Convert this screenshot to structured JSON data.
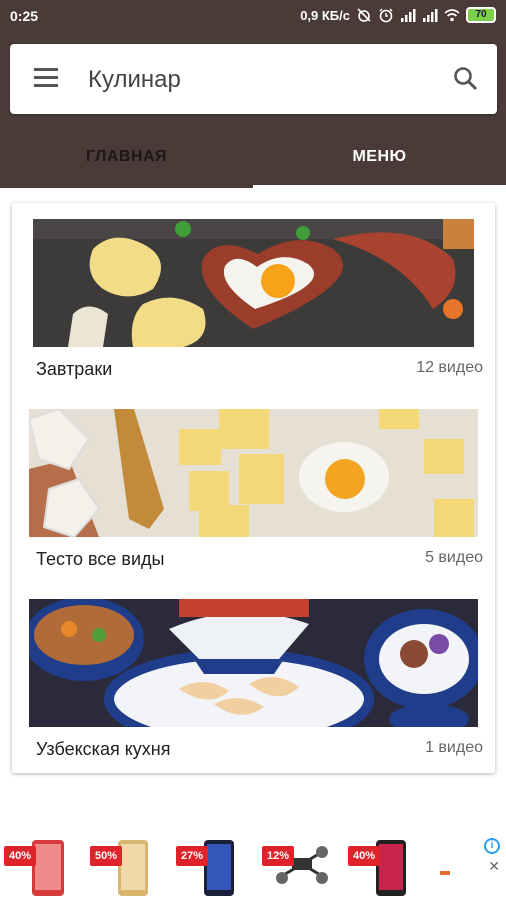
{
  "status_bar": {
    "time": "0:25",
    "speed": "0,9 КБ/с",
    "battery": "70",
    "icons": [
      "alarm-off-icon",
      "alarm-clock-icon",
      "signal-icon",
      "signal-icon",
      "wifi-icon",
      "battery-icon"
    ]
  },
  "search": {
    "title": "Кулинар",
    "menu_icon": "hamburger-menu-icon",
    "search_icon": "search-icon"
  },
  "tabs": [
    {
      "label": "ГЛАВНАЯ",
      "active": false
    },
    {
      "label": "МЕНЮ",
      "active": true
    }
  ],
  "categories": [
    {
      "label": "Завтраки",
      "count": "12 видео",
      "image": "breakfast-photo"
    },
    {
      "label": "Тесто все виды",
      "count": "5 видео",
      "image": "dough-photo"
    },
    {
      "label": "Узбекская кухня",
      "count": "1 видео",
      "image": "uzbek-cuisine-photo"
    }
  ],
  "ad": {
    "badges": [
      "40%",
      "50%",
      "27%",
      "12%",
      "40%"
    ],
    "info_icon": "ad-info-icon",
    "close_icon": "close-icon"
  },
  "colors": {
    "header_bg": "#4a3b39",
    "tab_active": "#ffffff",
    "tab_inactive": "#1e1716",
    "badge_red": "#e0232b"
  }
}
